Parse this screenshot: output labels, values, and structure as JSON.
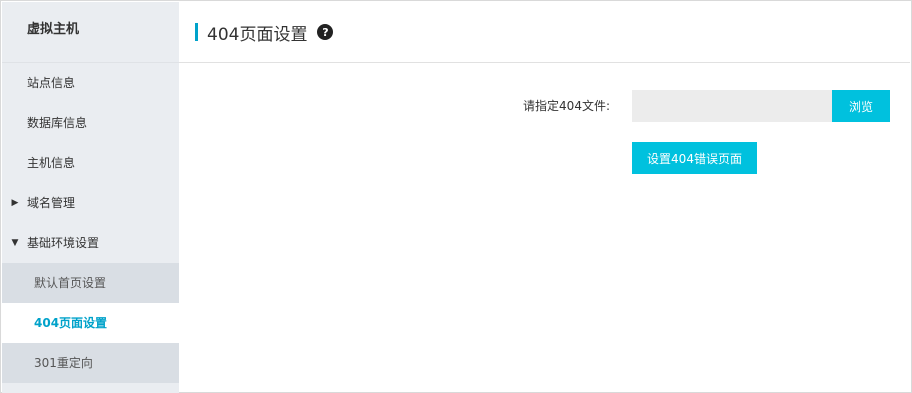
{
  "sidebar": {
    "title": "虚拟主机",
    "items": [
      {
        "label": "站点信息"
      },
      {
        "label": "数据库信息"
      },
      {
        "label": "主机信息"
      },
      {
        "label": "域名管理",
        "caret": "▶"
      },
      {
        "label": "基础环境设置",
        "caret": "▼"
      }
    ],
    "sub_items": [
      {
        "label": "默认首页设置"
      },
      {
        "label": "404页面设置"
      },
      {
        "label": "301重定向"
      }
    ]
  },
  "main": {
    "title": "404页面设置",
    "help_icon": "?",
    "form": {
      "file_label": "请指定404文件:",
      "file_value": "",
      "browse_label": "浏览",
      "submit_label": "设置404错误页面"
    }
  },
  "colors": {
    "accent": "#00c1de",
    "active_text": "#00a2ca",
    "sidebar_bg": "#eaedf1"
  }
}
